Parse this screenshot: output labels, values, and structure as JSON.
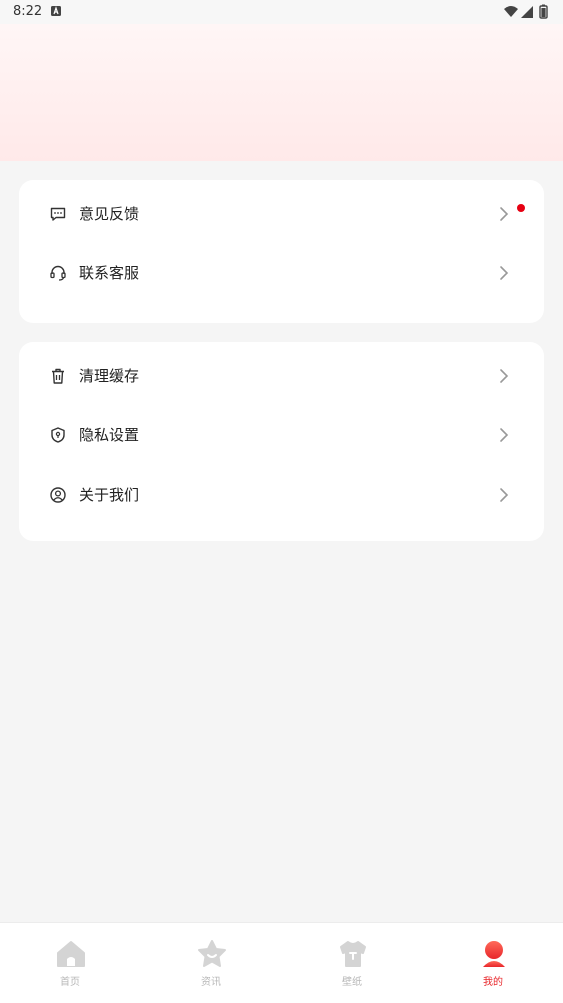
{
  "status_bar": {
    "time": "8:22"
  },
  "menu_group_1": [
    {
      "label": "意见反馈",
      "icon": "message-icon",
      "badge": true
    },
    {
      "label": "联系客服",
      "icon": "headset-icon",
      "badge": false
    }
  ],
  "menu_group_2": [
    {
      "label": "清理缓存",
      "icon": "trash-icon"
    },
    {
      "label": "隐私设置",
      "icon": "shield-icon"
    },
    {
      "label": "关于我们",
      "icon": "user-circle-icon"
    }
  ],
  "tabbar": {
    "items": [
      {
        "label": "首页",
        "icon": "home-icon"
      },
      {
        "label": "资讯",
        "icon": "star-icon"
      },
      {
        "label": "壁纸",
        "icon": "shirt-icon"
      },
      {
        "label": "我的",
        "icon": "profile-icon",
        "active": true
      }
    ]
  },
  "colors": {
    "accent": "#e8262a",
    "badge": "#e60012",
    "header_gradient": "#ffe9e9"
  }
}
